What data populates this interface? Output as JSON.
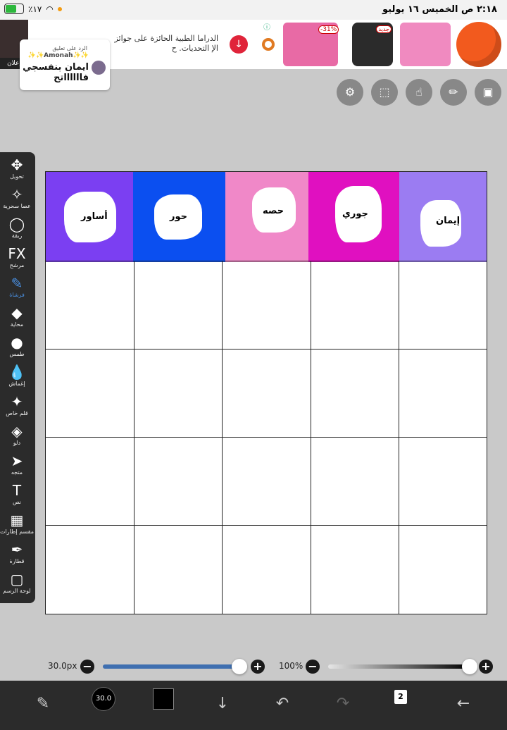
{
  "status": {
    "time_date": "٢:١٨ ص   الخميس ١٦ يوليو",
    "battery": "٪١٧"
  },
  "ad": {
    "label": "إعلان",
    "text": "الدراما الطبية الحائزة على جوائز الإ التحديات. ح",
    "info_icon": "info-icon",
    "product_tag_1": "-31%",
    "product_tag_2": "جديد"
  },
  "reply": {
    "meta": "الرد على تعليق",
    "name": "✨✨Amonah✨✨",
    "text": "ايمان بنفسجي فااااااتح"
  },
  "toolbar": {
    "items": [
      {
        "label": "تحويل",
        "icon": "✥"
      },
      {
        "label": "عصا سحرية",
        "icon": "✧"
      },
      {
        "label": "ربقة",
        "icon": "◯"
      },
      {
        "label": "مرشح",
        "icon": "FX"
      },
      {
        "label": "فرشاة",
        "icon": "✎"
      },
      {
        "label": "محاية",
        "icon": "◆"
      },
      {
        "label": "طمس",
        "icon": "●"
      },
      {
        "label": "إغماش",
        "icon": "💧"
      },
      {
        "label": "قلم خاص",
        "icon": "✦"
      },
      {
        "label": "دلو",
        "icon": "◈"
      },
      {
        "label": "متجه",
        "icon": "➤"
      },
      {
        "label": "نص",
        "icon": "T"
      },
      {
        "label": "مقسم إطارات",
        "icon": "▦"
      },
      {
        "label": "قطارة",
        "icon": "✒"
      },
      {
        "label": "لوحة الرسم",
        "icon": "▢"
      }
    ],
    "active_index": 4
  },
  "canvas": {
    "headers": [
      {
        "name": "أساور",
        "color": "#7b3ff2"
      },
      {
        "name": "حور",
        "color": "#0b4ff0"
      },
      {
        "name": "حصه",
        "color": "#f088c8"
      },
      {
        "name": "جوري",
        "color": "#e010c0"
      },
      {
        "name": "إيمان",
        "color": "#9b7cf2"
      }
    ]
  },
  "sliders": {
    "brush_size": "30.0px",
    "opacity": "100%",
    "brush_size_fraction": 1.0,
    "opacity_fraction": 1.0
  },
  "bottom": {
    "brush_value": "30.0",
    "layers_count": "2"
  }
}
